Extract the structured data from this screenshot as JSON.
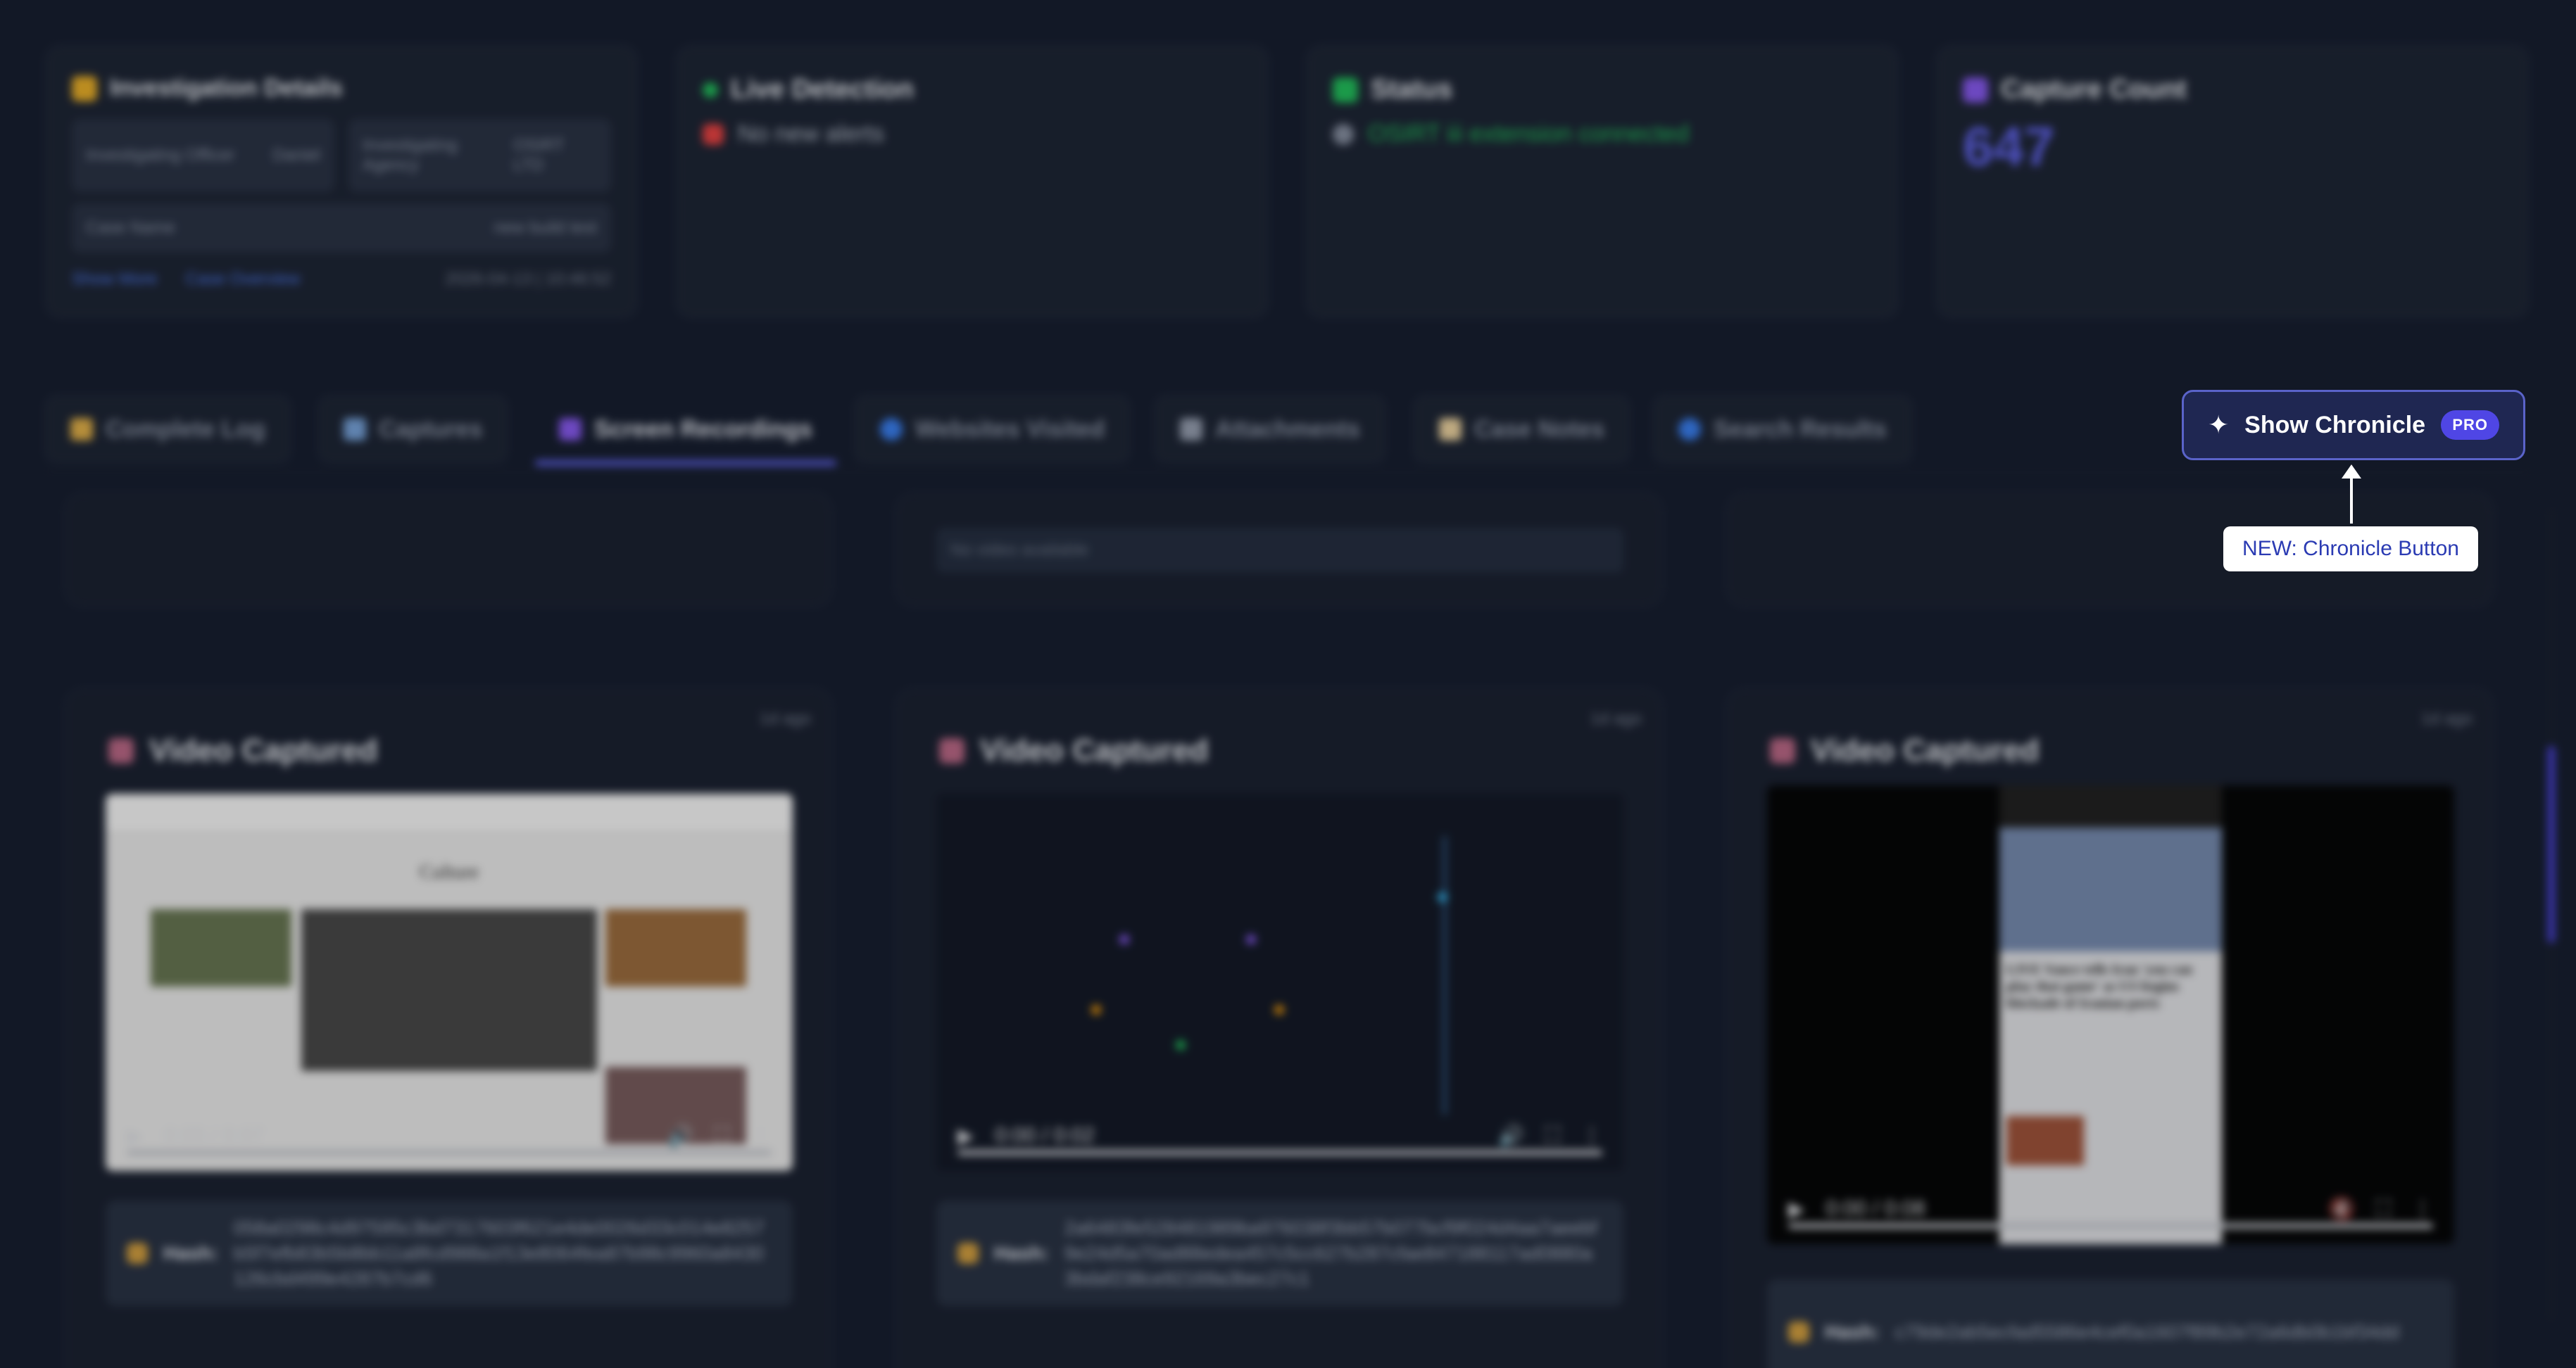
{
  "investigation": {
    "title": "Investigation Details",
    "officer_label": "Investigating Officer",
    "officer_value": "Daniel",
    "agency_label": "Investigating Agency",
    "agency_value": "OSIRT LTD",
    "case_label": "Case Name",
    "case_value": "new build test",
    "show_more": "Show More",
    "case_overview": "Case Overview",
    "timestamp": "2026-04-13 | 10:46:52"
  },
  "live_detection": {
    "title": "Live Detection",
    "message": "No new alerts"
  },
  "status": {
    "title": "Status",
    "message": "OSIRT iii extension connected",
    "color": "#22c55e"
  },
  "capture_count": {
    "title": "Capture Count",
    "value": "647",
    "color": "#6366f1"
  },
  "tabs": [
    {
      "label": "Complete Log",
      "icon": "ledger-icon"
    },
    {
      "label": "Captures",
      "icon": "photo-icon"
    },
    {
      "label": "Screen Recordings",
      "icon": "video-icon",
      "active": true
    },
    {
      "label": "Websites Visited",
      "icon": "globe-icon"
    },
    {
      "label": "Attachments",
      "icon": "paperclip-icon"
    },
    {
      "label": "Case Notes",
      "icon": "note-icon"
    },
    {
      "label": "Search Results",
      "icon": "search-icon"
    }
  ],
  "chronicle": {
    "label": "Show Chronicle",
    "badge": "PRO",
    "icon": "sparkle-icon"
  },
  "callout": {
    "text": "NEW: Chronicle Button"
  },
  "prev_row": {
    "no_video": "No video available"
  },
  "videos": [
    {
      "title": "Video Captured",
      "time": "1d ago",
      "player_time": "0:00 / 0:07",
      "thumb_heading": "Culture",
      "hash_label": "Hash:",
      "hash": "058a0298c4d97595c3bd7317603f621e4de0026d33c014e8257b5f7efb83b5b8bb11a8fcd988a1f13e8064fea87b98c9960a8430126cbd499e4287b7cd6"
    },
    {
      "title": "Video Captured",
      "time": "1d ago",
      "player_time": "0:00 / 0:02",
      "hash_label": "Hash:",
      "hash": "2a6483fe528481989ba976038f3bb57b077bcf9f024d4aa7aeebf9e24d5a70ad88edea457c5cc627b287cfae847188117ad0880a3bdaf238ce92169a3bec27c1"
    },
    {
      "title": "Video Captured",
      "time": "1d ago",
      "player_time": "0:00 / 0:08",
      "thumb_heading": "LIVE Vance tells Iran 'you can play that game' as US begins blockade of Iranian ports",
      "hash_label": "Hash:",
      "hash": "c79de2ab5ecfad5586e4cef0a1607f89b2e72a6db0b1bf34dd"
    }
  ],
  "colors": {
    "accent": "#6366f1",
    "background": "#121826",
    "card": "#1e2636"
  }
}
